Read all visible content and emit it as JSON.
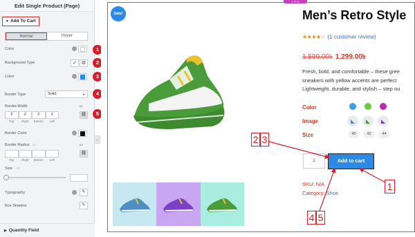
{
  "panel": {
    "title": "Edit Single Product (Page)",
    "section_label": "Add To Cart",
    "tabs": [
      "Normal",
      "Hover"
    ],
    "rows": {
      "color1": "Color",
      "background_type": "Background Type",
      "color2": "Color",
      "border_type": "Border Type",
      "border_type_value": "Solid",
      "border_width": "Border Width",
      "border_color": "Border Color",
      "border_radius": "Border Radius",
      "size": "Size",
      "typography": "Typography",
      "box_shadow": "Box Shadow",
      "unit": "px"
    },
    "border_width_values": [
      "2",
      "2",
      "2",
      "2"
    ],
    "dimension_captions": [
      "Top",
      "Right",
      "Bottom",
      "Left"
    ],
    "badges": [
      "1",
      "2",
      "3",
      "4",
      "5"
    ],
    "bottom_section": "Quantity Field"
  },
  "product": {
    "sale_badge": "Sale!",
    "title": "Men’s Retro Style",
    "rating_stars": 4,
    "review_link": "(1 customer review)",
    "old_price": "1,599.00৳",
    "new_price": "1,299.00৳",
    "description_lines": [
      "Fresh, bold, and comfortable – these gree",
      "sneakers with yellow accents are perfect",
      "Lightweight, durable, and stylish – step ou"
    ],
    "attributes": {
      "color_label": "Color",
      "image_label": "Image",
      "size_label": "Size",
      "colors": [
        "#3aa0e8",
        "#6ccc3c",
        "#c726b0"
      ],
      "sizes": [
        "40",
        "42",
        "44"
      ]
    },
    "quantity": "1",
    "add_to_cart_label": "Add to cart",
    "sku_label": "SKU:",
    "sku_value": "N/A",
    "category_label": "Category:",
    "category_value": "Shoe",
    "thumb_colors": [
      "#c7e8f0",
      "#c9a6f1",
      "#a8eddf"
    ]
  },
  "annotations": {
    "box_23": [
      "2",
      "3"
    ],
    "box_1": "1",
    "box_45": [
      "4",
      "5"
    ]
  },
  "colors": {
    "accent_red": "#d81e2c",
    "button_blue": "#2c8ae6",
    "editor_magenta": "#c73ec0"
  }
}
